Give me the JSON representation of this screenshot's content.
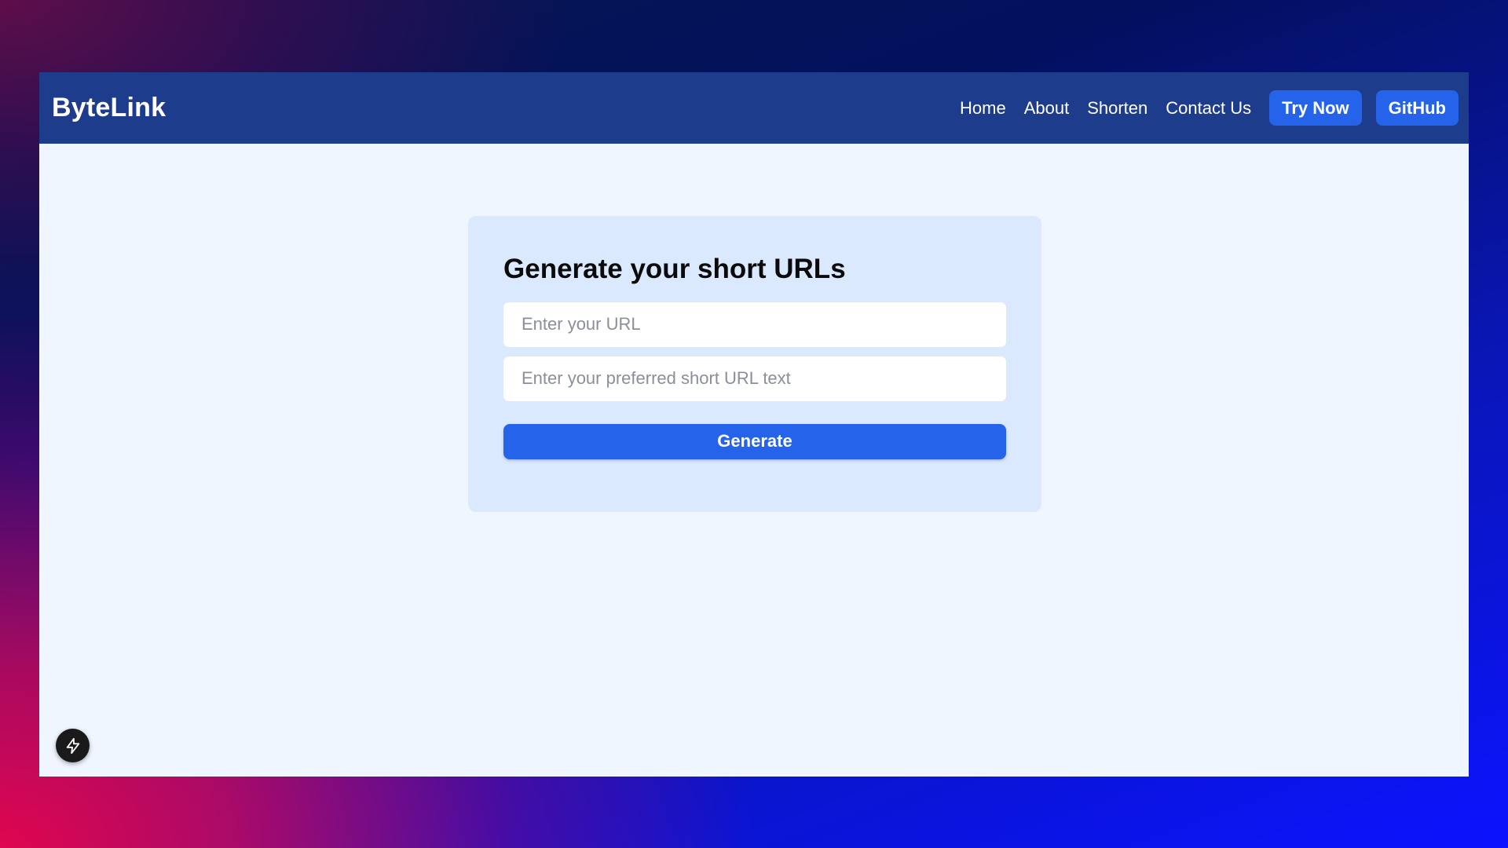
{
  "header": {
    "brand": "ByteLink",
    "nav": {
      "home": "Home",
      "about": "About",
      "shorten": "Shorten",
      "contact": "Contact Us"
    },
    "try_now": "Try Now",
    "github": "GitHub"
  },
  "form": {
    "title": "Generate your short URLs",
    "url_input": {
      "value": "",
      "placeholder": "Enter your URL"
    },
    "alias_input": {
      "value": "",
      "placeholder": "Enter your preferred short URL text"
    },
    "submit_label": "Generate"
  },
  "dev_tools": {
    "icon": "lightning-bolt-icon"
  },
  "colors": {
    "navbar": "#1e3c8c",
    "accent": "#2563eb",
    "page_bg": "#eff6ff",
    "card_bg": "#dbe9fe"
  }
}
